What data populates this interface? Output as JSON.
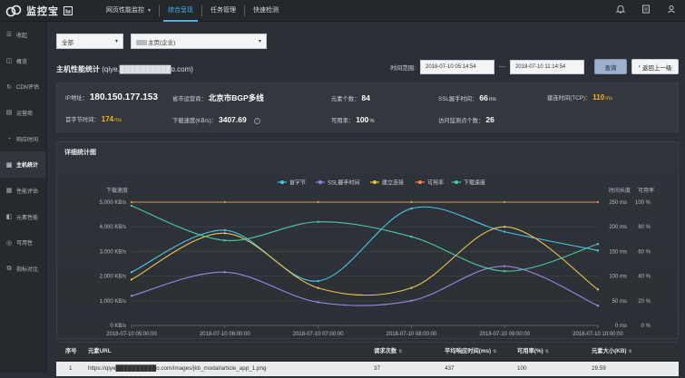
{
  "app": {
    "logo_text": "监控宝",
    "nav": [
      {
        "label": "网页性能监控",
        "caret": "▾"
      },
      {
        "label": "综合呈现"
      },
      {
        "label": "任务管理"
      },
      {
        "label": "快速检测"
      }
    ]
  },
  "sidebar": {
    "items": [
      {
        "label": "收起",
        "icon": "collapse-icon",
        "glyph": "☰"
      },
      {
        "label": "概览",
        "icon": "overview-icon",
        "glyph": "◫"
      },
      {
        "label": "CDN评估",
        "icon": "cdn-icon",
        "glyph": "↻"
      },
      {
        "label": "运营商",
        "icon": "isp-icon",
        "glyph": "▤"
      },
      {
        "label": "响应时间",
        "icon": "clock-icon",
        "glyph": "◔"
      },
      {
        "label": "主机统计",
        "icon": "host-icon",
        "glyph": "▣"
      },
      {
        "label": "性能评估",
        "icon": "performance-icon",
        "glyph": "▦"
      },
      {
        "label": "元素性能",
        "icon": "element-icon",
        "glyph": "◧"
      },
      {
        "label": "可用性",
        "icon": "availability-icon",
        "glyph": "◎"
      },
      {
        "label": "指标对比",
        "icon": "compare-icon",
        "glyph": "⧉"
      }
    ],
    "active_index": 5
  },
  "filters": {
    "scope": "全部",
    "page": "主页(企业)"
  },
  "header": {
    "title": "主机性能统计",
    "host": "(qiye.██████████o.com)",
    "time_label": "时间范围:",
    "start": "2018-07-10 05:14:54",
    "dash": "—",
    "end": "2018-07-10 11:14:54",
    "query_btn": "查询",
    "back_btn": "返回上一级"
  },
  "stats": {
    "ip_label": "IP地址：",
    "ip": "180.150.177.153",
    "isp_label": "省市运营商：",
    "isp": "北京市BGP多线",
    "elements_label": "元素个数：",
    "elements": "84",
    "ssl_label": "SSL握手时间：",
    "ssl": "66",
    "ssl_unit": "ms",
    "tcp_label": "建连时间(TCP)：",
    "tcp": "110",
    "tcp_unit": "ms",
    "ttfb_label": "首字节时间：",
    "ttfb": "174",
    "ttfb_unit": "ms",
    "speed_label": "下载速度(KB/s)：",
    "speed": "3407.69",
    "help": "?",
    "avail_label": "可用率：",
    "avail": "100",
    "avail_unit": "%",
    "probes_label": "访问监测点个数：",
    "probes": "26"
  },
  "chart": {
    "panel_title": "详细统计图",
    "left_axis_title": "下载速度",
    "right_axis_title_1": "时间长度",
    "right_axis_title_2": "可用率"
  },
  "chart_data": {
    "type": "line",
    "x": [
      "2018-07-10 05:00:00",
      "2018-07-10 06:00:00",
      "2018-07-10 07:00:00",
      "2018-07-10 08:00:00",
      "2018-07-10 09:00:00",
      "2018-07-10 10:00:00"
    ],
    "x_positions": [
      0,
      1,
      2,
      3,
      4,
      5
    ],
    "left_axis": {
      "min": 0,
      "max": 5000,
      "ticks": [
        "0 KB/s",
        "1,000 KB/s",
        "2,000 KB/s",
        "3,000 KB/s",
        "4,000 KB/s",
        "5,000 KB/s"
      ]
    },
    "right_axis_1": {
      "min": 0,
      "max": 250,
      "ticks": [
        "0 ms",
        "50 ms",
        "100 ms",
        "150 ms",
        "200 ms",
        "250 ms"
      ]
    },
    "right_axis_2": {
      "min": 0,
      "max": 100,
      "ticks": [
        "0 %",
        "20 %",
        "40 %",
        "60 %",
        "80 %",
        "100 %"
      ]
    },
    "grid": true,
    "legend_position": "top-center",
    "series": [
      {
        "name": "首字节",
        "color": "#4cc3e8",
        "axis": "ms",
        "x": [
          0,
          1,
          2,
          3,
          4,
          5
        ],
        "values": [
          108,
          193,
          90,
          237,
          190,
          152
        ]
      },
      {
        "name": "SSL握手时间",
        "color": "#9b86e0",
        "axis": "ms",
        "x": [
          0,
          1,
          2,
          3,
          4,
          5
        ],
        "values": [
          60,
          108,
          47,
          50,
          120,
          40
        ]
      },
      {
        "name": "建立连接",
        "color": "#e8c548",
        "axis": "ms",
        "x": [
          0,
          1,
          2,
          3,
          4,
          5
        ],
        "values": [
          93,
          187,
          76,
          76,
          200,
          73
        ]
      },
      {
        "name": "可用率",
        "color": "#f0894c",
        "axis": "%",
        "x": [
          0,
          1,
          2,
          3,
          4,
          5
        ],
        "values": [
          100,
          100,
          100,
          100,
          100,
          100
        ]
      },
      {
        "name": "下载速度",
        "color": "#4fc7a0",
        "axis": "KB/s",
        "x": [
          0,
          1,
          2,
          3,
          4,
          5
        ],
        "values": [
          4850,
          3450,
          4200,
          3600,
          2200,
          3300
        ]
      }
    ]
  },
  "table": {
    "headers": [
      "序号",
      "元素URL",
      "请求次数",
      "平均响应时间(ms)",
      "可用率(%)",
      "元素大小(KB)"
    ],
    "sort_glyph": "⇅",
    "rows": [
      [
        "1",
        "https://qiye██████████o.com/images/jkb_modal/article_app_1.png",
        "37",
        "437",
        "100",
        "29.59"
      ]
    ]
  }
}
